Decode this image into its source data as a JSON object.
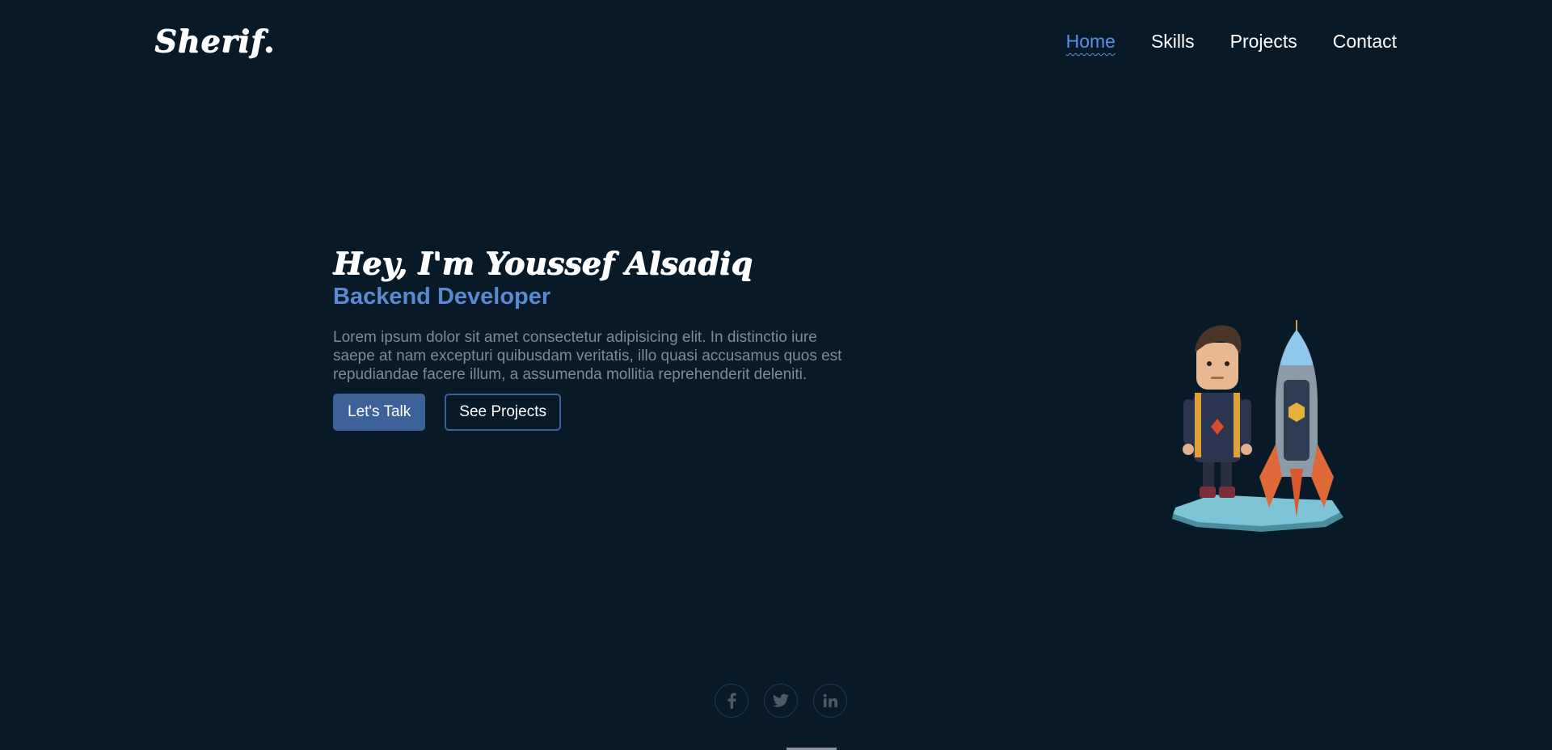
{
  "header": {
    "logo": "Sherif.",
    "nav": [
      {
        "label": "Home",
        "active": true
      },
      {
        "label": "Skills",
        "active": false
      },
      {
        "label": "Projects",
        "active": false
      },
      {
        "label": "Contact",
        "active": false
      }
    ]
  },
  "hero": {
    "title": "Hey, I'm Youssef Alsadiq",
    "role": "Backend Developer",
    "description": "Lorem ipsum dolor sit amet consectetur adipisicing elit. In distinctio iure saepe at nam excepturi quibusdam veritatis, illo quasi accusamus quos est repudiandae facere illum, a assumenda mollitia reprehenderit deleniti.",
    "primary_button": "Let's Talk",
    "secondary_button": "See Projects"
  },
  "social": {
    "icons": [
      "facebook-icon",
      "twitter-icon",
      "linkedin-icon"
    ]
  },
  "colors": {
    "background": "#081a28",
    "accent": "#5b8ad0",
    "button": "#3d6299",
    "muted_text": "#7e8a96"
  }
}
